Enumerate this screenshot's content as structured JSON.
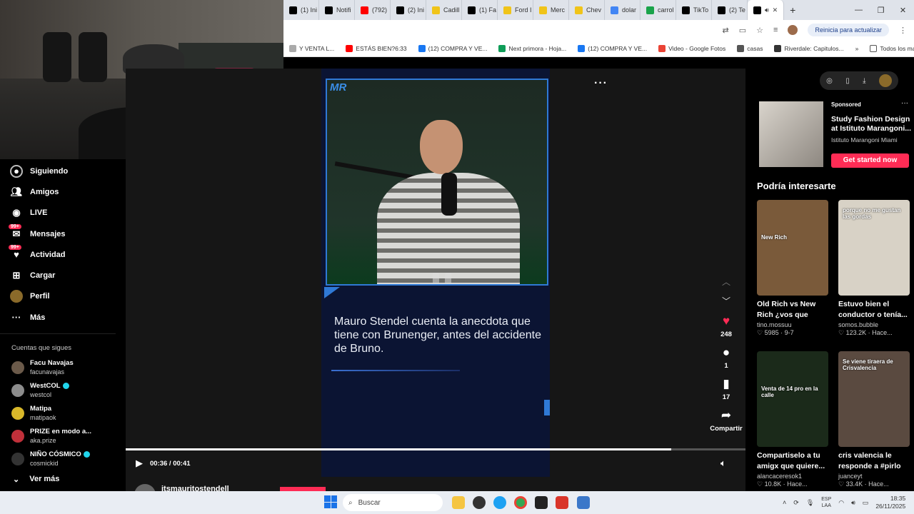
{
  "browser": {
    "tabs": [
      {
        "label": "(1) Ini",
        "color": "#000000"
      },
      {
        "label": "Notifi",
        "color": "#000000"
      },
      {
        "label": "(792)",
        "color": "#ff0000"
      },
      {
        "label": "(2) Ini",
        "color": "#000000"
      },
      {
        "label": "Cadill",
        "color": "#f0c419"
      },
      {
        "label": "(1) Fa",
        "color": "#000000"
      },
      {
        "label": "Ford I",
        "color": "#f0c419"
      },
      {
        "label": "Merc",
        "color": "#f0c419"
      },
      {
        "label": "Chev",
        "color": "#f0c419"
      },
      {
        "label": "dolar",
        "color": "#4285f4"
      },
      {
        "label": "carrol",
        "color": "#1aa34a"
      },
      {
        "label": "TikTo",
        "color": "#000000"
      },
      {
        "label": "(2) Te",
        "color": "#000000"
      }
    ],
    "update_label": "Reinicia para actualizar",
    "bookmarks": [
      {
        "label": "Y VENTA L...",
        "color": "#aaaaaa"
      },
      {
        "label": "ESTÁS BIEN?6:33",
        "color": "#ff0000"
      },
      {
        "label": "(12) COMPRA Y VE...",
        "color": "#1877f2"
      },
      {
        "label": "Next primora - Hoja...",
        "color": "#0f9d58"
      },
      {
        "label": "(12) COMPRA Y VE...",
        "color": "#1877f2"
      },
      {
        "label": "Video - Google Fotos",
        "color": "#ea4335"
      },
      {
        "label": "casas",
        "color": "#555555"
      },
      {
        "label": "Riverdale: Capitulos...",
        "color": "#333333"
      }
    ],
    "all_bookmarks": "Todos los marcadores"
  },
  "nav": {
    "items": [
      {
        "label": "Siguiendo",
        "icon": "following-icon"
      },
      {
        "label": "Amigos",
        "icon": "friends-icon"
      },
      {
        "label": "LIVE",
        "icon": "live-icon"
      },
      {
        "label": "Mensajes",
        "icon": "messages-icon",
        "badge": "99+"
      },
      {
        "label": "Actividad",
        "icon": "activity-icon",
        "badge": "99+"
      },
      {
        "label": "Cargar",
        "icon": "upload-icon"
      },
      {
        "label": "Perfil",
        "icon": "profile-icon"
      },
      {
        "label": "Más",
        "icon": "more-icon"
      }
    ],
    "following_title": "Cuentas que sigues",
    "accounts": [
      {
        "name": "Facu Navajas",
        "user": "facunavajas",
        "verified": false,
        "color": "#6b5a4a"
      },
      {
        "name": "WestCOL",
        "user": "westcol",
        "verified": true,
        "color": "#8c8c8c"
      },
      {
        "name": "Matipa",
        "user": "matipaok",
        "verified": false,
        "color": "#d9b82a"
      },
      {
        "name": "PRIZE en modo a...",
        "user": "aka.prize",
        "verified": false,
        "color": "#c0303a"
      },
      {
        "name": "NIÑO CÓSMICO",
        "user": "cosmickid",
        "verified": true,
        "color": "#333333"
      }
    ],
    "see_more": "Ver más"
  },
  "video": {
    "caption": "Mauro Stendel cuenta la anecdota que tiene con Brunenger, antes del accidente de Bruno.",
    "logo": "MR",
    "time": "00:36 / 00:41",
    "progress": 0.88,
    "likes": "248",
    "comments": "1",
    "saves": "17",
    "share_label": "Compartir",
    "author": "itsmauritostendell"
  },
  "ad": {
    "sponsored": "Sponsored",
    "title": "Study Fashion Design at Istituto Marangoni...",
    "advertiser": "Istituto Marangoni Miami",
    "cta": "Get started now"
  },
  "suggest": {
    "title": "Podría interesarte",
    "cards": [
      {
        "title": "Old Rich vs New Rich ¿vos que preferis?",
        "author": "tino.mossuu",
        "meta": "♡ 5985 · 9-7",
        "label": "New Rich",
        "bg": "#7a5a3a"
      },
      {
        "title": "Estuvo bien el conductor o tenía...",
        "author": "somos.bubble",
        "meta": "♡ 123.2K · Hace...",
        "label": "porque no me gustan las gordas",
        "bg": "#d8d2c6"
      },
      {
        "title": "Compartiselo a tu amigx que quiere...",
        "author": "alancaceresok1",
        "meta": "♡ 10.8K · Hace...",
        "label": "Venta de 14 pro en la calle",
        "bg": "#1b2a1a"
      },
      {
        "title": "cris valencia le responde a #pirlo i...",
        "author": "juanceyt",
        "meta": "♡ 33.4K · Hace...",
        "label": "Se viene tiraera de Crisvalencia",
        "bg": "#5a4a40"
      }
    ]
  },
  "taskbar": {
    "search": "Buscar",
    "lang1": "ESP",
    "lang2": "LAA",
    "time": "18:35",
    "date": "26/11/2025"
  }
}
